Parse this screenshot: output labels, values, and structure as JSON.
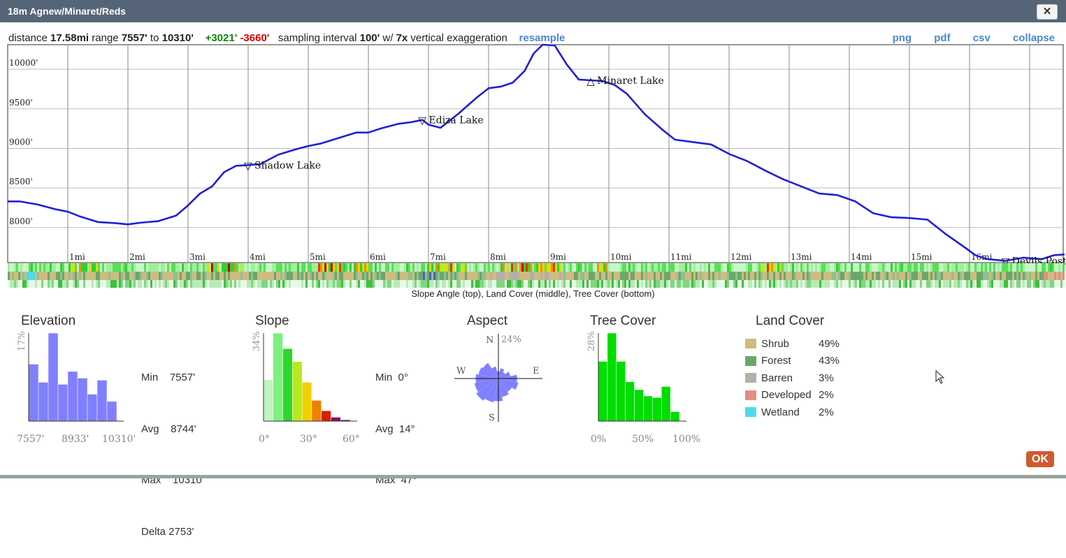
{
  "window": {
    "title": "18m Agnew/Minaret/Reds",
    "close_icon": "close-icon"
  },
  "summary": {
    "distance_label": "distance",
    "distance": "17.58mi",
    "range_label": "range",
    "range_min": "7557'",
    "range_to": "to",
    "range_max": "10310'",
    "gain": "+3021'",
    "loss": "-3660'",
    "interval_label": "sampling interval",
    "interval": "100'",
    "exag_label": "w/",
    "exag": "7x",
    "exag_suffix": "vertical exaggeration",
    "resample": "resample"
  },
  "exports": {
    "png": "png",
    "pdf": "pdf",
    "csv": "csv",
    "collapse": "collapse"
  },
  "profile": {
    "line_color": "#1f1fd6",
    "y_ticks": [
      "8000'",
      "8500'",
      "9000'",
      "9500'",
      "10000'"
    ],
    "y_values": [
      8000,
      8500,
      9000,
      9500,
      10000
    ],
    "x_ticks": [
      "1mi",
      "2mi",
      "3mi",
      "4mi",
      "5mi",
      "6mi",
      "7mi",
      "8mi",
      "9mi",
      "10mi",
      "11mi",
      "12mi",
      "13mi",
      "14mi",
      "15mi",
      "16mi"
    ],
    "x_max_mi": 17.58,
    "y_min": 7557,
    "y_max": 10310,
    "elevation": [
      [
        0,
        8330
      ],
      [
        0.2,
        8330
      ],
      [
        0.5,
        8290
      ],
      [
        0.8,
        8230
      ],
      [
        1.0,
        8200
      ],
      [
        1.2,
        8140
      ],
      [
        1.5,
        8070
      ],
      [
        1.8,
        8055
      ],
      [
        2.0,
        8040
      ],
      [
        2.2,
        8060
      ],
      [
        2.5,
        8080
      ],
      [
        2.8,
        8150
      ],
      [
        3.0,
        8280
      ],
      [
        3.2,
        8430
      ],
      [
        3.4,
        8520
      ],
      [
        3.6,
        8700
      ],
      [
        3.8,
        8780
      ],
      [
        4.0,
        8790
      ],
      [
        4.2,
        8800
      ],
      [
        4.5,
        8920
      ],
      [
        4.8,
        8990
      ],
      [
        5.0,
        9030
      ],
      [
        5.2,
        9060
      ],
      [
        5.5,
        9130
      ],
      [
        5.8,
        9200
      ],
      [
        6.0,
        9200
      ],
      [
        6.2,
        9250
      ],
      [
        6.5,
        9310
      ],
      [
        6.7,
        9330
      ],
      [
        6.9,
        9360
      ],
      [
        7.0,
        9300
      ],
      [
        7.2,
        9260
      ],
      [
        7.5,
        9440
      ],
      [
        7.8,
        9640
      ],
      [
        8.0,
        9760
      ],
      [
        8.2,
        9780
      ],
      [
        8.4,
        9830
      ],
      [
        8.6,
        9980
      ],
      [
        8.75,
        10200
      ],
      [
        8.9,
        10310
      ],
      [
        9.1,
        10300
      ],
      [
        9.3,
        10060
      ],
      [
        9.5,
        9870
      ],
      [
        9.7,
        9860
      ],
      [
        9.9,
        9850
      ],
      [
        10.1,
        9800
      ],
      [
        10.3,
        9690
      ],
      [
        10.6,
        9430
      ],
      [
        10.9,
        9230
      ],
      [
        11.1,
        9110
      ],
      [
        11.4,
        9080
      ],
      [
        11.7,
        9050
      ],
      [
        12.0,
        8930
      ],
      [
        12.3,
        8840
      ],
      [
        12.6,
        8720
      ],
      [
        12.9,
        8610
      ],
      [
        13.2,
        8520
      ],
      [
        13.5,
        8430
      ],
      [
        13.8,
        8410
      ],
      [
        14.1,
        8330
      ],
      [
        14.4,
        8180
      ],
      [
        14.7,
        8130
      ],
      [
        15.0,
        8120
      ],
      [
        15.3,
        8100
      ],
      [
        15.6,
        7920
      ],
      [
        15.9,
        7760
      ],
      [
        16.1,
        7650
      ],
      [
        16.3,
        7600
      ],
      [
        16.6,
        7580
      ],
      [
        16.9,
        7620
      ],
      [
        17.2,
        7600
      ],
      [
        17.4,
        7650
      ],
      [
        17.58,
        7660
      ]
    ],
    "waypoints": [
      {
        "name": "Shadow Lake",
        "mi": 4.0,
        "elev": 8790,
        "symbol": "▽"
      },
      {
        "name": "Ediza Lake",
        "mi": 6.9,
        "elev": 9360,
        "symbol": "▽"
      },
      {
        "name": "Minaret Lake",
        "mi": 9.7,
        "elev": 9860,
        "symbol": "△"
      },
      {
        "name": "Devils Postpile",
        "mi": 16.6,
        "elev": 7580,
        "symbol": "▽"
      }
    ]
  },
  "band_caption": "Slope Angle (top), Land Cover (middle), Tree Cover (bottom)",
  "elevation_hist": {
    "title": "Elevation",
    "y_label": "17%",
    "x_labels": [
      "7557'",
      "8933'",
      "10310'"
    ],
    "values": [
      11,
      7.5,
      17,
      7.1,
      9.6,
      8.3,
      5.2,
      7.9,
      3.8
    ],
    "color": "#8080ff",
    "stats": [
      "Min    7557'",
      "Avg    8744'",
      "Max    10310'",
      "Delta 2753'"
    ]
  },
  "slope_hist": {
    "title": "Slope",
    "y_label": "34%",
    "x_labels": [
      "0°",
      "30°",
      "60°"
    ],
    "values": [
      16,
      34,
      28,
      23,
      15,
      8,
      4,
      1.5,
      0.5
    ],
    "colors": [
      "#c0f4c0",
      "#7ef07e",
      "#2fd62f",
      "#b7e820",
      "#f0d000",
      "#f08000",
      "#d82000",
      "#801060",
      "#402070"
    ],
    "stats": [
      "Min  0°",
      "Avg  14°",
      "Max  47°"
    ]
  },
  "aspect": {
    "title": "Aspect",
    "pct_label": "24%",
    "dirs": [
      "N",
      "E",
      "S",
      "W"
    ],
    "petals": [
      0.18,
      0.26,
      0.2,
      0.3,
      0.46,
      0.5,
      0.4,
      0.46,
      0.56,
      0.6,
      0.66,
      0.6,
      0.56,
      0.5,
      0.46,
      0.3
    ],
    "color": "#8080ff"
  },
  "tree_hist": {
    "title": "Tree Cover",
    "y_label": "28%",
    "x_labels": [
      "0%",
      "50%",
      "100%"
    ],
    "values": [
      19,
      28,
      19,
      12.5,
      10,
      8,
      7.5,
      11,
      3
    ],
    "color": "#00dd00"
  },
  "land_cover": {
    "title": "Land Cover",
    "items": [
      {
        "name": "Shrub",
        "pct": "49%",
        "color": "#cdbc80"
      },
      {
        "name": "Forest",
        "pct": "43%",
        "color": "#6aa86a"
      },
      {
        "name": "Barren",
        "pct": "3%",
        "color": "#b4b0a8"
      },
      {
        "name": "Developed",
        "pct": "2%",
        "color": "#e09080"
      },
      {
        "name": "Wetland",
        "pct": "2%",
        "color": "#50d8ee"
      }
    ]
  },
  "ok": "OK"
}
